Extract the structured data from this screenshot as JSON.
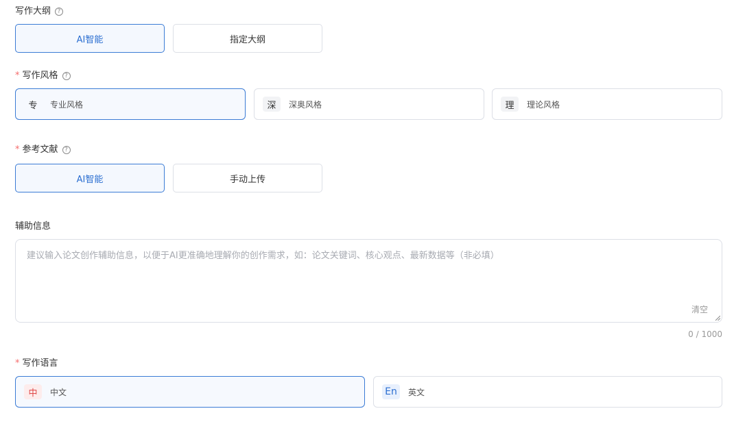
{
  "outline": {
    "label": "写作大纲",
    "options": [
      "AI智能",
      "指定大纲"
    ],
    "selected": 0
  },
  "style": {
    "label": "写作风格",
    "required_mark": "*",
    "options": [
      {
        "badge": "专",
        "label": "专业风格"
      },
      {
        "badge": "深",
        "label": "深奥风格"
      },
      {
        "badge": "理",
        "label": "理论风格"
      }
    ],
    "selected": 0
  },
  "references": {
    "label": "参考文献",
    "required_mark": "*",
    "options": [
      "AI智能",
      "手动上传"
    ],
    "selected": 0
  },
  "aux": {
    "label": "辅助信息",
    "placeholder": "建议输入论文创作辅助信息，以便于AI更准确地理解你的创作需求，如：论文关键词、核心观点、最新数据等（非必填）",
    "clear_label": "清空",
    "counter": "0 / 1000"
  },
  "language": {
    "label": "写作语言",
    "required_mark": "*",
    "options": [
      {
        "badge": "中",
        "label": "中文"
      },
      {
        "badge": "En",
        "label": "英文"
      }
    ],
    "selected": 0
  },
  "help_glyph": "?",
  "colors": {
    "accent": "#3a7bd5",
    "required": "#f56c6c"
  }
}
